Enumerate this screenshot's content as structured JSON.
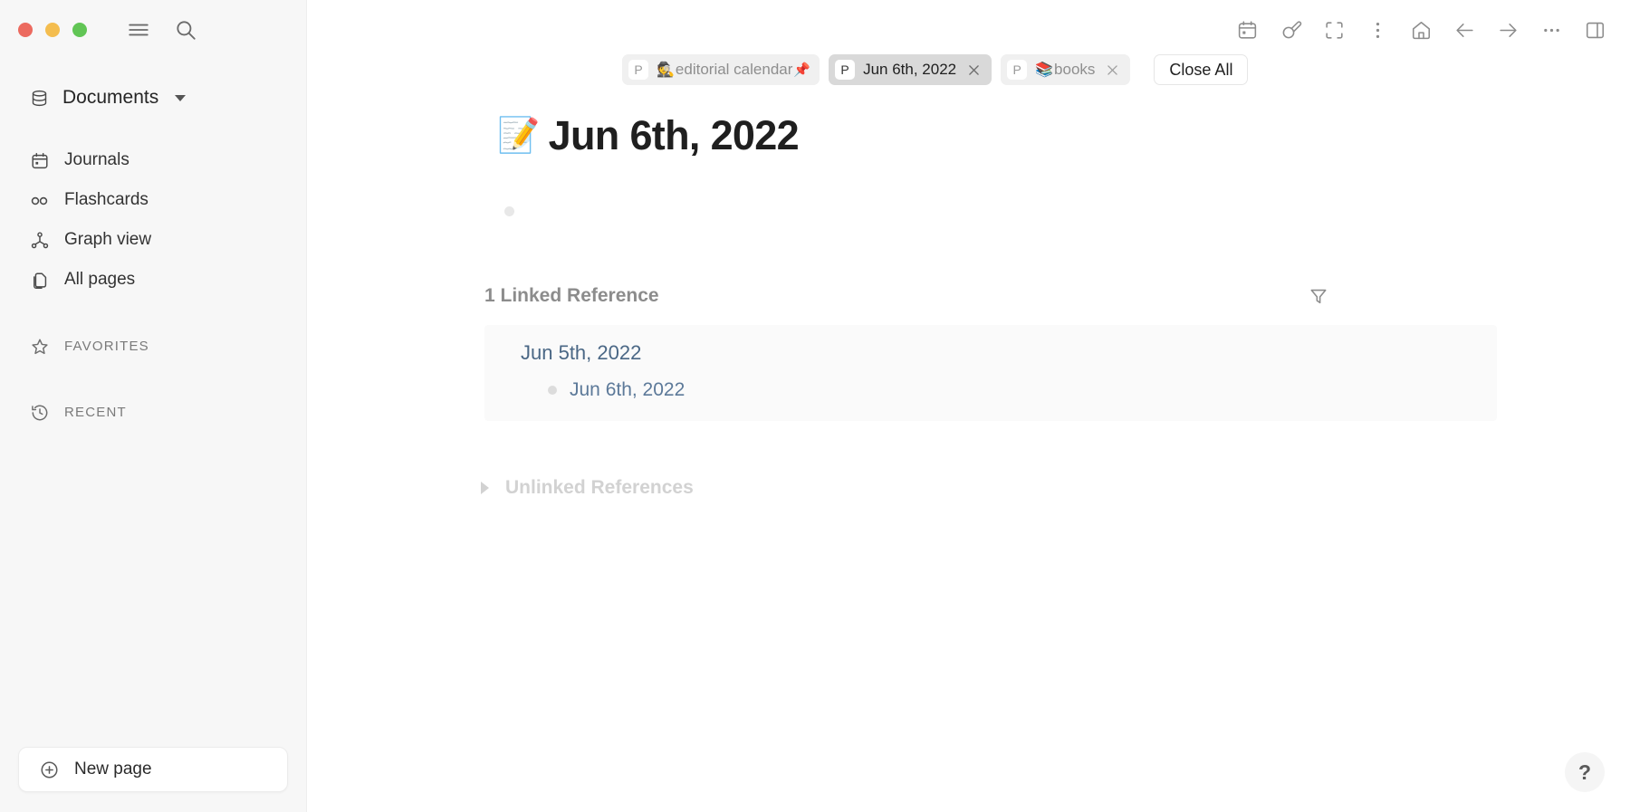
{
  "window": {
    "traffic_lights": {
      "close_color": "#ec6a5f",
      "minimize_color": "#f4bd4f",
      "maximize_color": "#61c555"
    }
  },
  "sidebar": {
    "graph_switcher": {
      "label": "Documents",
      "icon": "database-icon"
    },
    "items": [
      {
        "label": "Journals",
        "icon": "calendar-icon"
      },
      {
        "label": "Flashcards",
        "icon": "infinity-icon"
      },
      {
        "label": "Graph view",
        "icon": "graph-icon"
      },
      {
        "label": "All pages",
        "icon": "pages-icon"
      }
    ],
    "groups": [
      {
        "label": "FAVORITES",
        "icon": "star-icon"
      },
      {
        "label": "RECENT",
        "icon": "clock-icon"
      }
    ],
    "new_page_label": "New page",
    "background_color": "#f7f7f7"
  },
  "toolbar": {
    "buttons": [
      {
        "name": "calendar-icon",
        "title": "Journals"
      },
      {
        "name": "pencil-circle-icon",
        "title": "Quick capture"
      },
      {
        "name": "focus-brackets-icon",
        "title": "Focus mode"
      },
      {
        "name": "vertical-dots-icon",
        "title": "More"
      },
      {
        "name": "home-icon",
        "title": "Home"
      },
      {
        "name": "arrow-left-icon",
        "title": "Back"
      },
      {
        "name": "arrow-right-icon",
        "title": "Forward"
      },
      {
        "name": "horizontal-dots-icon",
        "title": "More options"
      },
      {
        "name": "right-sidebar-icon",
        "title": "Toggle right sidebar"
      }
    ]
  },
  "tabbar": {
    "tabs": [
      {
        "badge": "P",
        "emoji": "🕵️",
        "label": "editorial calendar",
        "pin": "📌",
        "pinned": true,
        "active": false,
        "closable": false
      },
      {
        "badge": "P",
        "emoji": "",
        "label": "Jun 6th, 2022",
        "pin": "",
        "pinned": false,
        "active": true,
        "closable": true
      },
      {
        "badge": "P",
        "emoji": "📚",
        "label": "books",
        "pin": "",
        "pinned": false,
        "active": false,
        "closable": true
      }
    ],
    "close_all_label": "Close All"
  },
  "page": {
    "title_emoji": "📝",
    "title": "Jun 6th, 2022",
    "blocks": [
      {
        "text": ""
      }
    ],
    "linked_references": {
      "heading": "1 Linked Reference",
      "count": 1,
      "filter_icon": "filter-funnel-icon",
      "groups": [
        {
          "page": "Jun 5th, 2022",
          "blocks": [
            {
              "text": "Jun 6th, 2022"
            }
          ]
        }
      ]
    },
    "unlinked_references": {
      "heading": "Unlinked References",
      "collapsed": true
    }
  },
  "help": {
    "label": "?"
  }
}
